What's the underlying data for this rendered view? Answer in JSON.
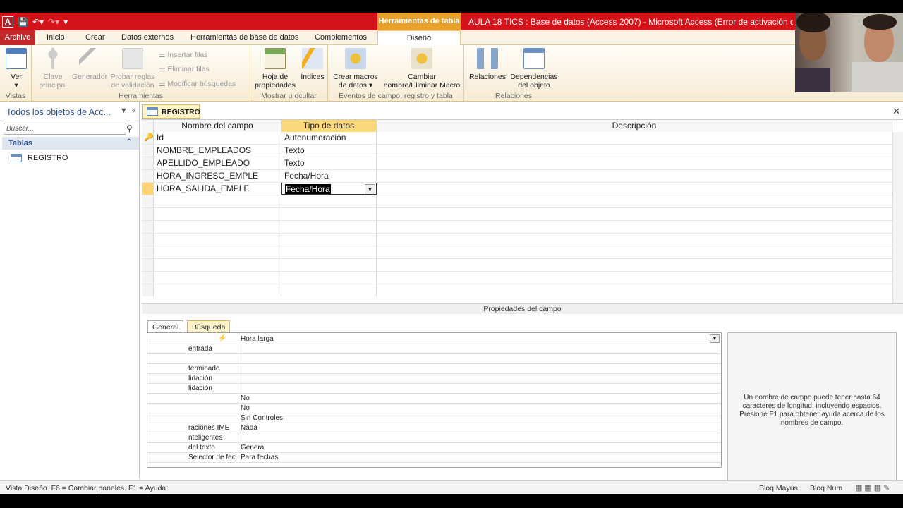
{
  "window": {
    "title": "AULA 18 TICS : Base de datos (Access 2007) - Microsoft Access (Error de activación de producto)",
    "context_header": "Herramientas de tabla",
    "app_icon_letter": "A"
  },
  "tabs": [
    "Archivo",
    "Inicio",
    "Crear",
    "Datos externos",
    "Herramientas de base de datos",
    "Complementos",
    "Diseño"
  ],
  "ribbon": {
    "vistas": {
      "label": "Vistas",
      "ver": "Ver"
    },
    "herramientas": {
      "label": "Herramientas",
      "clave_principal": [
        "Clave",
        "principal"
      ],
      "generador": "Generador",
      "probar_reglas": [
        "Probar reglas",
        "de validación"
      ],
      "insertar_filas": "Insertar filas",
      "eliminar_filas": "Eliminar filas",
      "modificar_busquedas": "Modificar búsquedas"
    },
    "mostrar": {
      "label": "Mostrar u ocultar",
      "hoja_propiedades": [
        "Hoja de",
        "propiedades"
      ],
      "indices": "Índices"
    },
    "eventos": {
      "label": "Eventos de campo, registro y tabla",
      "crear_macros": [
        "Crear macros",
        "de datos"
      ],
      "cambiar_nombre": [
        "Cambiar",
        "nombre/Eliminar Macro"
      ]
    },
    "relaciones": {
      "label": "Relaciones",
      "relaciones": "Relaciones",
      "dependencias": [
        "Dependencias",
        "del objeto"
      ]
    }
  },
  "nav": {
    "header": "Todos los objetos de Acc...",
    "search_placeholder": "Buscar...",
    "group": "Tablas",
    "items": [
      "REGISTRO"
    ]
  },
  "document": {
    "tab": "REGISTRO",
    "columns": [
      "Nombre del campo",
      "Tipo de datos",
      "Descripción"
    ],
    "rows": [
      {
        "name": "Id",
        "type": "Autonumeración",
        "desc": ""
      },
      {
        "name": "NOMBRE_EMPLEADOS",
        "type": "Texto",
        "desc": ""
      },
      {
        "name": "APELLIDO_EMPLEADO",
        "type": "Texto",
        "desc": ""
      },
      {
        "name": "HORA_INGRESO_EMPLE",
        "type": "Fecha/Hora",
        "desc": ""
      },
      {
        "name": "HORA_SALIDA_EMPLE",
        "type": "Fecha/Hora",
        "desc": ""
      }
    ]
  },
  "properties": {
    "title": "Propiedades del campo",
    "tabs": [
      "General",
      "Búsqueda"
    ],
    "rows": [
      {
        "label": "",
        "value": "Hora larga"
      },
      {
        "label": "entrada",
        "value": ""
      },
      {
        "label": "",
        "value": ""
      },
      {
        "label": "terminado",
        "value": ""
      },
      {
        "label": "lidación",
        "value": ""
      },
      {
        "label": "lidación",
        "value": ""
      },
      {
        "label": "",
        "value": "No"
      },
      {
        "label": "",
        "value": "No"
      },
      {
        "label": "",
        "value": "Sin Controles"
      },
      {
        "label": "raciones IME",
        "value": "Nada"
      },
      {
        "label": "nteligentes",
        "value": ""
      },
      {
        "label": "del texto",
        "value": "General"
      },
      {
        "label": "Selector de fec",
        "value": "Para fechas"
      }
    ],
    "help": "Un nombre de campo puede tener hasta 64 caracteres de longitud, incluyendo espacios. Presione F1 para obtener ayuda acerca de los nombres de campo."
  },
  "status": {
    "left": "Vista Diseño.  F6 = Cambiar paneles.  F1 = Ayuda.",
    "caps": "Bloq Mayús",
    "num": "Bloq Num"
  },
  "colors": {
    "titlebar": "#d4121a",
    "context": "#e9a12b",
    "selection": "#fbd87a"
  }
}
